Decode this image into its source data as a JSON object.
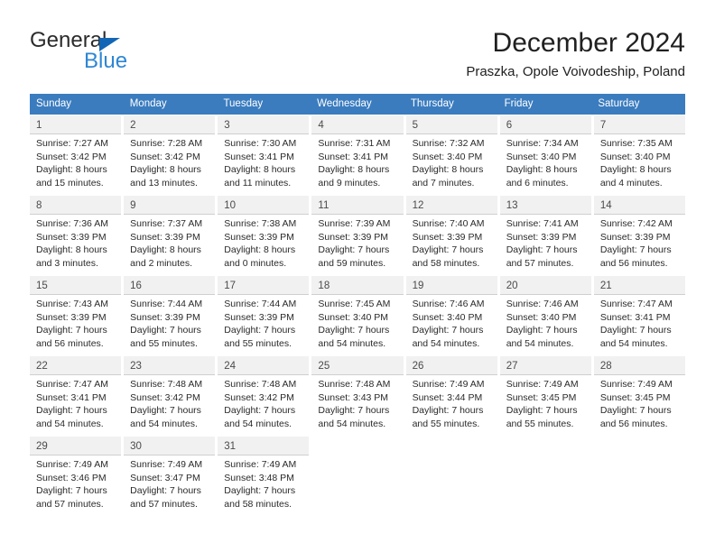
{
  "logo": {
    "word1": "General",
    "word2": "Blue",
    "triangle_color": "#1266b5",
    "word2_color": "#2e86d4"
  },
  "header": {
    "title": "December 2024",
    "subtitle": "Praszka, Opole Voivodeship, Poland"
  },
  "theme": {
    "header_row_bg": "#3b7cbf",
    "header_row_text": "#ffffff",
    "daynum_bg": "#f1f1f1",
    "cell_text": "#2a2a2a"
  },
  "weekdays": [
    "Sunday",
    "Monday",
    "Tuesday",
    "Wednesday",
    "Thursday",
    "Friday",
    "Saturday"
  ],
  "weeks": [
    [
      {
        "day": "1",
        "sunrise": "Sunrise: 7:27 AM",
        "sunset": "Sunset: 3:42 PM",
        "daylight1": "Daylight: 8 hours",
        "daylight2": "and 15 minutes."
      },
      {
        "day": "2",
        "sunrise": "Sunrise: 7:28 AM",
        "sunset": "Sunset: 3:42 PM",
        "daylight1": "Daylight: 8 hours",
        "daylight2": "and 13 minutes."
      },
      {
        "day": "3",
        "sunrise": "Sunrise: 7:30 AM",
        "sunset": "Sunset: 3:41 PM",
        "daylight1": "Daylight: 8 hours",
        "daylight2": "and 11 minutes."
      },
      {
        "day": "4",
        "sunrise": "Sunrise: 7:31 AM",
        "sunset": "Sunset: 3:41 PM",
        "daylight1": "Daylight: 8 hours",
        "daylight2": "and 9 minutes."
      },
      {
        "day": "5",
        "sunrise": "Sunrise: 7:32 AM",
        "sunset": "Sunset: 3:40 PM",
        "daylight1": "Daylight: 8 hours",
        "daylight2": "and 7 minutes."
      },
      {
        "day": "6",
        "sunrise": "Sunrise: 7:34 AM",
        "sunset": "Sunset: 3:40 PM",
        "daylight1": "Daylight: 8 hours",
        "daylight2": "and 6 minutes."
      },
      {
        "day": "7",
        "sunrise": "Sunrise: 7:35 AM",
        "sunset": "Sunset: 3:40 PM",
        "daylight1": "Daylight: 8 hours",
        "daylight2": "and 4 minutes."
      }
    ],
    [
      {
        "day": "8",
        "sunrise": "Sunrise: 7:36 AM",
        "sunset": "Sunset: 3:39 PM",
        "daylight1": "Daylight: 8 hours",
        "daylight2": "and 3 minutes."
      },
      {
        "day": "9",
        "sunrise": "Sunrise: 7:37 AM",
        "sunset": "Sunset: 3:39 PM",
        "daylight1": "Daylight: 8 hours",
        "daylight2": "and 2 minutes."
      },
      {
        "day": "10",
        "sunrise": "Sunrise: 7:38 AM",
        "sunset": "Sunset: 3:39 PM",
        "daylight1": "Daylight: 8 hours",
        "daylight2": "and 0 minutes."
      },
      {
        "day": "11",
        "sunrise": "Sunrise: 7:39 AM",
        "sunset": "Sunset: 3:39 PM",
        "daylight1": "Daylight: 7 hours",
        "daylight2": "and 59 minutes."
      },
      {
        "day": "12",
        "sunrise": "Sunrise: 7:40 AM",
        "sunset": "Sunset: 3:39 PM",
        "daylight1": "Daylight: 7 hours",
        "daylight2": "and 58 minutes."
      },
      {
        "day": "13",
        "sunrise": "Sunrise: 7:41 AM",
        "sunset": "Sunset: 3:39 PM",
        "daylight1": "Daylight: 7 hours",
        "daylight2": "and 57 minutes."
      },
      {
        "day": "14",
        "sunrise": "Sunrise: 7:42 AM",
        "sunset": "Sunset: 3:39 PM",
        "daylight1": "Daylight: 7 hours",
        "daylight2": "and 56 minutes."
      }
    ],
    [
      {
        "day": "15",
        "sunrise": "Sunrise: 7:43 AM",
        "sunset": "Sunset: 3:39 PM",
        "daylight1": "Daylight: 7 hours",
        "daylight2": "and 56 minutes."
      },
      {
        "day": "16",
        "sunrise": "Sunrise: 7:44 AM",
        "sunset": "Sunset: 3:39 PM",
        "daylight1": "Daylight: 7 hours",
        "daylight2": "and 55 minutes."
      },
      {
        "day": "17",
        "sunrise": "Sunrise: 7:44 AM",
        "sunset": "Sunset: 3:39 PM",
        "daylight1": "Daylight: 7 hours",
        "daylight2": "and 55 minutes."
      },
      {
        "day": "18",
        "sunrise": "Sunrise: 7:45 AM",
        "sunset": "Sunset: 3:40 PM",
        "daylight1": "Daylight: 7 hours",
        "daylight2": "and 54 minutes."
      },
      {
        "day": "19",
        "sunrise": "Sunrise: 7:46 AM",
        "sunset": "Sunset: 3:40 PM",
        "daylight1": "Daylight: 7 hours",
        "daylight2": "and 54 minutes."
      },
      {
        "day": "20",
        "sunrise": "Sunrise: 7:46 AM",
        "sunset": "Sunset: 3:40 PM",
        "daylight1": "Daylight: 7 hours",
        "daylight2": "and 54 minutes."
      },
      {
        "day": "21",
        "sunrise": "Sunrise: 7:47 AM",
        "sunset": "Sunset: 3:41 PM",
        "daylight1": "Daylight: 7 hours",
        "daylight2": "and 54 minutes."
      }
    ],
    [
      {
        "day": "22",
        "sunrise": "Sunrise: 7:47 AM",
        "sunset": "Sunset: 3:41 PM",
        "daylight1": "Daylight: 7 hours",
        "daylight2": "and 54 minutes."
      },
      {
        "day": "23",
        "sunrise": "Sunrise: 7:48 AM",
        "sunset": "Sunset: 3:42 PM",
        "daylight1": "Daylight: 7 hours",
        "daylight2": "and 54 minutes."
      },
      {
        "day": "24",
        "sunrise": "Sunrise: 7:48 AM",
        "sunset": "Sunset: 3:42 PM",
        "daylight1": "Daylight: 7 hours",
        "daylight2": "and 54 minutes."
      },
      {
        "day": "25",
        "sunrise": "Sunrise: 7:48 AM",
        "sunset": "Sunset: 3:43 PM",
        "daylight1": "Daylight: 7 hours",
        "daylight2": "and 54 minutes."
      },
      {
        "day": "26",
        "sunrise": "Sunrise: 7:49 AM",
        "sunset": "Sunset: 3:44 PM",
        "daylight1": "Daylight: 7 hours",
        "daylight2": "and 55 minutes."
      },
      {
        "day": "27",
        "sunrise": "Sunrise: 7:49 AM",
        "sunset": "Sunset: 3:45 PM",
        "daylight1": "Daylight: 7 hours",
        "daylight2": "and 55 minutes."
      },
      {
        "day": "28",
        "sunrise": "Sunrise: 7:49 AM",
        "sunset": "Sunset: 3:45 PM",
        "daylight1": "Daylight: 7 hours",
        "daylight2": "and 56 minutes."
      }
    ],
    [
      {
        "day": "29",
        "sunrise": "Sunrise: 7:49 AM",
        "sunset": "Sunset: 3:46 PM",
        "daylight1": "Daylight: 7 hours",
        "daylight2": "and 57 minutes."
      },
      {
        "day": "30",
        "sunrise": "Sunrise: 7:49 AM",
        "sunset": "Sunset: 3:47 PM",
        "daylight1": "Daylight: 7 hours",
        "daylight2": "and 57 minutes."
      },
      {
        "day": "31",
        "sunrise": "Sunrise: 7:49 AM",
        "sunset": "Sunset: 3:48 PM",
        "daylight1": "Daylight: 7 hours",
        "daylight2": "and 58 minutes."
      },
      {
        "day": "",
        "sunrise": "",
        "sunset": "",
        "daylight1": "",
        "daylight2": ""
      },
      {
        "day": "",
        "sunrise": "",
        "sunset": "",
        "daylight1": "",
        "daylight2": ""
      },
      {
        "day": "",
        "sunrise": "",
        "sunset": "",
        "daylight1": "",
        "daylight2": ""
      },
      {
        "day": "",
        "sunrise": "",
        "sunset": "",
        "daylight1": "",
        "daylight2": ""
      }
    ]
  ]
}
